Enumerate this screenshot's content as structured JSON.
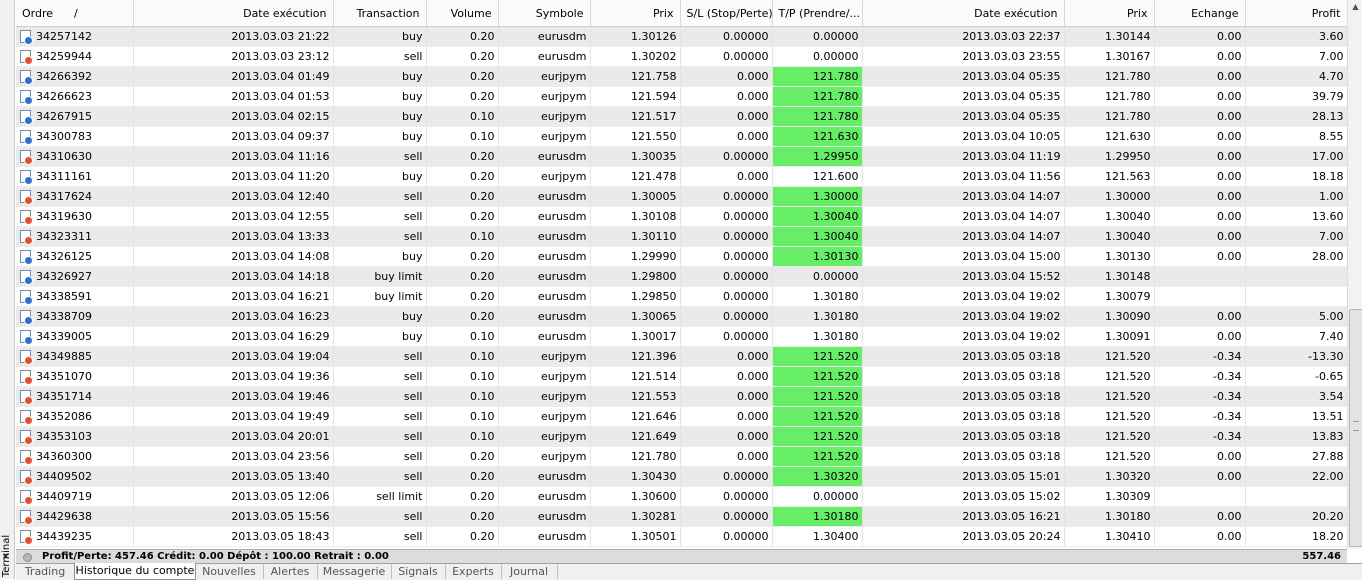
{
  "window": {
    "side_label": "Terminal",
    "close_glyph": "×"
  },
  "columns": [
    "Ordre",
    "Date exécution",
    "Transaction",
    "Volume",
    "Symbole",
    "Prix",
    "S/L (Stop/Perte)",
    "T/P (Prendre/...",
    "Date exécution",
    "Prix",
    "Echange",
    "Profit"
  ],
  "sort_indicator": "/",
  "colors": {
    "tp_highlight": "#66ee66",
    "buy_icon_dot": "#2d6fd2",
    "sell_icon_dot": "#e0502a"
  },
  "orders": [
    {
      "ordre": "34257142",
      "open_time": "2013.03.03 21:22",
      "type": "buy",
      "volume": "0.20",
      "symbol": "eurusdm",
      "price": "1.30126",
      "sl": "0.00000",
      "tp": "0.00000",
      "tp_hit": false,
      "close_time": "2013.03.03 22:37",
      "close_price": "1.30144",
      "swap": "0.00",
      "profit": "3.60"
    },
    {
      "ordre": "34259944",
      "open_time": "2013.03.03 23:12",
      "type": "sell",
      "volume": "0.20",
      "symbol": "eurusdm",
      "price": "1.30202",
      "sl": "0.00000",
      "tp": "0.00000",
      "tp_hit": false,
      "close_time": "2013.03.03 23:55",
      "close_price": "1.30167",
      "swap": "0.00",
      "profit": "7.00"
    },
    {
      "ordre": "34266392",
      "open_time": "2013.03.04 01:49",
      "type": "buy",
      "volume": "0.20",
      "symbol": "eurjpym",
      "price": "121.758",
      "sl": "0.000",
      "tp": "121.780",
      "tp_hit": true,
      "close_time": "2013.03.04 05:35",
      "close_price": "121.780",
      "swap": "0.00",
      "profit": "4.70"
    },
    {
      "ordre": "34266623",
      "open_time": "2013.03.04 01:53",
      "type": "buy",
      "volume": "0.20",
      "symbol": "eurjpym",
      "price": "121.594",
      "sl": "0.000",
      "tp": "121.780",
      "tp_hit": true,
      "close_time": "2013.03.04 05:35",
      "close_price": "121.780",
      "swap": "0.00",
      "profit": "39.79"
    },
    {
      "ordre": "34267915",
      "open_time": "2013.03.04 02:15",
      "type": "buy",
      "volume": "0.10",
      "symbol": "eurjpym",
      "price": "121.517",
      "sl": "0.000",
      "tp": "121.780",
      "tp_hit": true,
      "close_time": "2013.03.04 05:35",
      "close_price": "121.780",
      "swap": "0.00",
      "profit": "28.13"
    },
    {
      "ordre": "34300783",
      "open_time": "2013.03.04 09:37",
      "type": "buy",
      "volume": "0.10",
      "symbol": "eurjpym",
      "price": "121.550",
      "sl": "0.000",
      "tp": "121.630",
      "tp_hit": true,
      "close_time": "2013.03.04 10:05",
      "close_price": "121.630",
      "swap": "0.00",
      "profit": "8.55"
    },
    {
      "ordre": "34310630",
      "open_time": "2013.03.04 11:16",
      "type": "sell",
      "volume": "0.20",
      "symbol": "eurusdm",
      "price": "1.30035",
      "sl": "0.00000",
      "tp": "1.29950",
      "tp_hit": true,
      "close_time": "2013.03.04 11:19",
      "close_price": "1.29950",
      "swap": "0.00",
      "profit": "17.00"
    },
    {
      "ordre": "34311161",
      "open_time": "2013.03.04 11:20",
      "type": "buy",
      "volume": "0.20",
      "symbol": "eurjpym",
      "price": "121.478",
      "sl": "0.000",
      "tp": "121.600",
      "tp_hit": false,
      "close_time": "2013.03.04 11:56",
      "close_price": "121.563",
      "swap": "0.00",
      "profit": "18.18"
    },
    {
      "ordre": "34317624",
      "open_time": "2013.03.04 12:40",
      "type": "sell",
      "volume": "0.20",
      "symbol": "eurusdm",
      "price": "1.30005",
      "sl": "0.00000",
      "tp": "1.30000",
      "tp_hit": true,
      "close_time": "2013.03.04 14:07",
      "close_price": "1.30000",
      "swap": "0.00",
      "profit": "1.00"
    },
    {
      "ordre": "34319630",
      "open_time": "2013.03.04 12:55",
      "type": "sell",
      "volume": "0.20",
      "symbol": "eurusdm",
      "price": "1.30108",
      "sl": "0.00000",
      "tp": "1.30040",
      "tp_hit": true,
      "close_time": "2013.03.04 14:07",
      "close_price": "1.30040",
      "swap": "0.00",
      "profit": "13.60"
    },
    {
      "ordre": "34323311",
      "open_time": "2013.03.04 13:33",
      "type": "sell",
      "volume": "0.10",
      "symbol": "eurusdm",
      "price": "1.30110",
      "sl": "0.00000",
      "tp": "1.30040",
      "tp_hit": true,
      "close_time": "2013.03.04 14:07",
      "close_price": "1.30040",
      "swap": "0.00",
      "profit": "7.00"
    },
    {
      "ordre": "34326125",
      "open_time": "2013.03.04 14:08",
      "type": "buy",
      "volume": "0.20",
      "symbol": "eurusdm",
      "price": "1.29990",
      "sl": "0.00000",
      "tp": "1.30130",
      "tp_hit": true,
      "close_time": "2013.03.04 15:00",
      "close_price": "1.30130",
      "swap": "0.00",
      "profit": "28.00"
    },
    {
      "ordre": "34326927",
      "open_time": "2013.03.04 14:18",
      "type": "buy limit",
      "volume": "0.20",
      "symbol": "eurusdm",
      "price": "1.29800",
      "sl": "0.00000",
      "tp": "0.00000",
      "tp_hit": false,
      "close_time": "2013.03.04 15:52",
      "close_price": "1.30148",
      "swap": "",
      "profit": ""
    },
    {
      "ordre": "34338591",
      "open_time": "2013.03.04 16:21",
      "type": "buy limit",
      "volume": "0.20",
      "symbol": "eurusdm",
      "price": "1.29850",
      "sl": "0.00000",
      "tp": "1.30180",
      "tp_hit": false,
      "close_time": "2013.03.04 19:02",
      "close_price": "1.30079",
      "swap": "",
      "profit": ""
    },
    {
      "ordre": "34338709",
      "open_time": "2013.03.04 16:23",
      "type": "buy",
      "volume": "0.20",
      "symbol": "eurusdm",
      "price": "1.30065",
      "sl": "0.00000",
      "tp": "1.30180",
      "tp_hit": false,
      "close_time": "2013.03.04 19:02",
      "close_price": "1.30090",
      "swap": "0.00",
      "profit": "5.00"
    },
    {
      "ordre": "34339005",
      "open_time": "2013.03.04 16:29",
      "type": "buy",
      "volume": "0.10",
      "symbol": "eurusdm",
      "price": "1.30017",
      "sl": "0.00000",
      "tp": "1.30180",
      "tp_hit": false,
      "close_time": "2013.03.04 19:02",
      "close_price": "1.30091",
      "swap": "0.00",
      "profit": "7.40"
    },
    {
      "ordre": "34349885",
      "open_time": "2013.03.04 19:04",
      "type": "sell",
      "volume": "0.10",
      "symbol": "eurjpym",
      "price": "121.396",
      "sl": "0.000",
      "tp": "121.520",
      "tp_hit": true,
      "close_time": "2013.03.05 03:18",
      "close_price": "121.520",
      "swap": "-0.34",
      "profit": "-13.30"
    },
    {
      "ordre": "34351070",
      "open_time": "2013.03.04 19:36",
      "type": "sell",
      "volume": "0.10",
      "symbol": "eurjpym",
      "price": "121.514",
      "sl": "0.000",
      "tp": "121.520",
      "tp_hit": true,
      "close_time": "2013.03.05 03:18",
      "close_price": "121.520",
      "swap": "-0.34",
      "profit": "-0.65"
    },
    {
      "ordre": "34351714",
      "open_time": "2013.03.04 19:46",
      "type": "sell",
      "volume": "0.10",
      "symbol": "eurjpym",
      "price": "121.553",
      "sl": "0.000",
      "tp": "121.520",
      "tp_hit": true,
      "close_time": "2013.03.05 03:18",
      "close_price": "121.520",
      "swap": "-0.34",
      "profit": "3.54"
    },
    {
      "ordre": "34352086",
      "open_time": "2013.03.04 19:49",
      "type": "sell",
      "volume": "0.10",
      "symbol": "eurjpym",
      "price": "121.646",
      "sl": "0.000",
      "tp": "121.520",
      "tp_hit": true,
      "close_time": "2013.03.05 03:18",
      "close_price": "121.520",
      "swap": "-0.34",
      "profit": "13.51"
    },
    {
      "ordre": "34353103",
      "open_time": "2013.03.04 20:01",
      "type": "sell",
      "volume": "0.10",
      "symbol": "eurjpym",
      "price": "121.649",
      "sl": "0.000",
      "tp": "121.520",
      "tp_hit": true,
      "close_time": "2013.03.05 03:18",
      "close_price": "121.520",
      "swap": "-0.34",
      "profit": "13.83"
    },
    {
      "ordre": "34360300",
      "open_time": "2013.03.04 23:56",
      "type": "sell",
      "volume": "0.20",
      "symbol": "eurjpym",
      "price": "121.780",
      "sl": "0.000",
      "tp": "121.520",
      "tp_hit": true,
      "close_time": "2013.03.05 03:18",
      "close_price": "121.520",
      "swap": "0.00",
      "profit": "27.88"
    },
    {
      "ordre": "34409502",
      "open_time": "2013.03.05 13:40",
      "type": "sell",
      "volume": "0.20",
      "symbol": "eurusdm",
      "price": "1.30430",
      "sl": "0.00000",
      "tp": "1.30320",
      "tp_hit": true,
      "close_time": "2013.03.05 15:01",
      "close_price": "1.30320",
      "swap": "0.00",
      "profit": "22.00"
    },
    {
      "ordre": "34409719",
      "open_time": "2013.03.05 12:06",
      "type": "sell limit",
      "volume": "0.20",
      "symbol": "eurusdm",
      "price": "1.30600",
      "sl": "0.00000",
      "tp": "0.00000",
      "tp_hit": false,
      "close_time": "2013.03.05 15:02",
      "close_price": "1.30309",
      "swap": "",
      "profit": ""
    },
    {
      "ordre": "34429638",
      "open_time": "2013.03.05 15:56",
      "type": "sell",
      "volume": "0.20",
      "symbol": "eurusdm",
      "price": "1.30281",
      "sl": "0.00000",
      "tp": "1.30180",
      "tp_hit": true,
      "close_time": "2013.03.05 16:21",
      "close_price": "1.30180",
      "swap": "0.00",
      "profit": "20.20"
    },
    {
      "ordre": "34439235",
      "open_time": "2013.03.05 18:43",
      "type": "sell",
      "volume": "0.20",
      "symbol": "eurusdm",
      "price": "1.30501",
      "sl": "0.00000",
      "tp": "1.30400",
      "tp_hit": false,
      "close_time": "2013.03.05 20:24",
      "close_price": "1.30410",
      "swap": "0.00",
      "profit": "18.20"
    }
  ],
  "summary": {
    "text": "Profit/Perte: 457.46  Crédit: 0.00  Dépôt : 100.00  Retrait : 0.00",
    "total": "557.46"
  },
  "tabs": [
    "Trading",
    "Historique du compte",
    "Nouvelles",
    "Alertes",
    "Messagerie",
    "Signals",
    "Experts",
    "Journal"
  ],
  "active_tab": "Historique du compte"
}
